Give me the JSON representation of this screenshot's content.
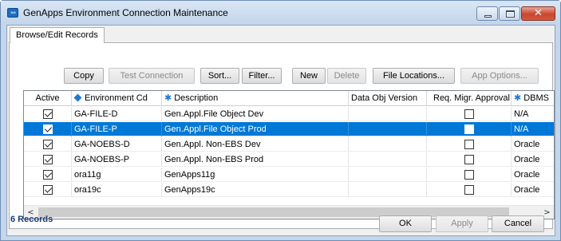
{
  "window": {
    "icon": "app-icon",
    "icon_glyph": "»»",
    "title": "GenApps Environment Connection Maintenance",
    "close_glyph": "✕"
  },
  "tabs": [
    {
      "label": "Browse/Edit Records",
      "active": true
    }
  ],
  "toolbar": {
    "copy": "Copy",
    "test_connection": "Test Connection",
    "sort": "Sort...",
    "filter": "Filter...",
    "new": "New",
    "delete": "Delete",
    "file_locations": "File Locations...",
    "app_options": "App Options..."
  },
  "grid": {
    "columns": {
      "active": "Active",
      "environment_cd": "Environment Cd",
      "description": "Description",
      "data_obj_version": "Data Obj Version",
      "req_migr_approval": "Req. Migr. Approval",
      "dbms": "DBMS"
    },
    "rows": [
      {
        "active": true,
        "environment_cd": "GA-FILE-D",
        "description": "Gen.Appl.File Object Dev",
        "data_obj_version": "",
        "req_migr_approval": false,
        "dbms": "N/A",
        "selected": false
      },
      {
        "active": true,
        "environment_cd": "GA-FILE-P",
        "description": "Gen.Appl.File Object Prod",
        "data_obj_version": "",
        "req_migr_approval": false,
        "dbms": "N/A",
        "selected": true
      },
      {
        "active": true,
        "environment_cd": "GA-NOEBS-D",
        "description": "Gen.Appl. Non-EBS Dev",
        "data_obj_version": "",
        "req_migr_approval": false,
        "dbms": "Oracle",
        "selected": false
      },
      {
        "active": true,
        "environment_cd": "GA-NOEBS-P",
        "description": "Gen.Appl. Non-EBS Prod",
        "data_obj_version": "",
        "req_migr_approval": false,
        "dbms": "Oracle",
        "selected": false
      },
      {
        "active": true,
        "environment_cd": "ora11g",
        "description": "GenApps11g",
        "data_obj_version": "",
        "req_migr_approval": false,
        "dbms": "Oracle",
        "selected": false
      },
      {
        "active": true,
        "environment_cd": "ora19c",
        "description": "GenApps19c",
        "data_obj_version": "",
        "req_migr_approval": false,
        "dbms": "Oracle",
        "selected": false
      }
    ],
    "scroll_left": "<",
    "scroll_right": ">"
  },
  "footer": {
    "records": "6 Records",
    "ok": "OK",
    "apply": "Apply",
    "cancel": "Cancel"
  },
  "colors": {
    "selection": "#0078d7",
    "key_icon": "#1e78d6",
    "records_text": "#1a3a7a"
  }
}
